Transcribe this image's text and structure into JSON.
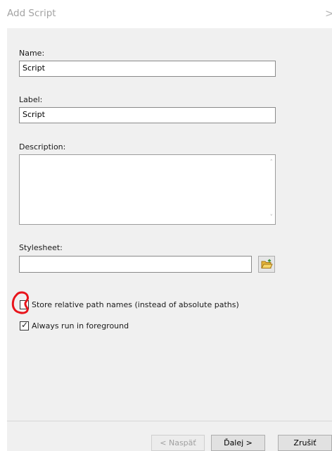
{
  "window": {
    "title": "Add Script",
    "close_glyph": ">"
  },
  "fields": {
    "name_label": "Name:",
    "name_value": "Script",
    "label_label": "Label:",
    "label_value": "Script",
    "description_label": "Description:",
    "description_value": "",
    "stylesheet_label": "Stylesheet:",
    "stylesheet_value": ""
  },
  "options": {
    "relative_paths_label": "Store relative path names (instead of absolute paths)",
    "relative_paths_checked": false,
    "foreground_label": "Always run in foreground",
    "foreground_checked": true
  },
  "buttons": {
    "back_label": "< Naspäť",
    "next_label": "Ďalej >",
    "cancel_label": "Zrušiť"
  },
  "colors": {
    "annotation": "#e8141b",
    "panel": "#f0f0f0"
  }
}
